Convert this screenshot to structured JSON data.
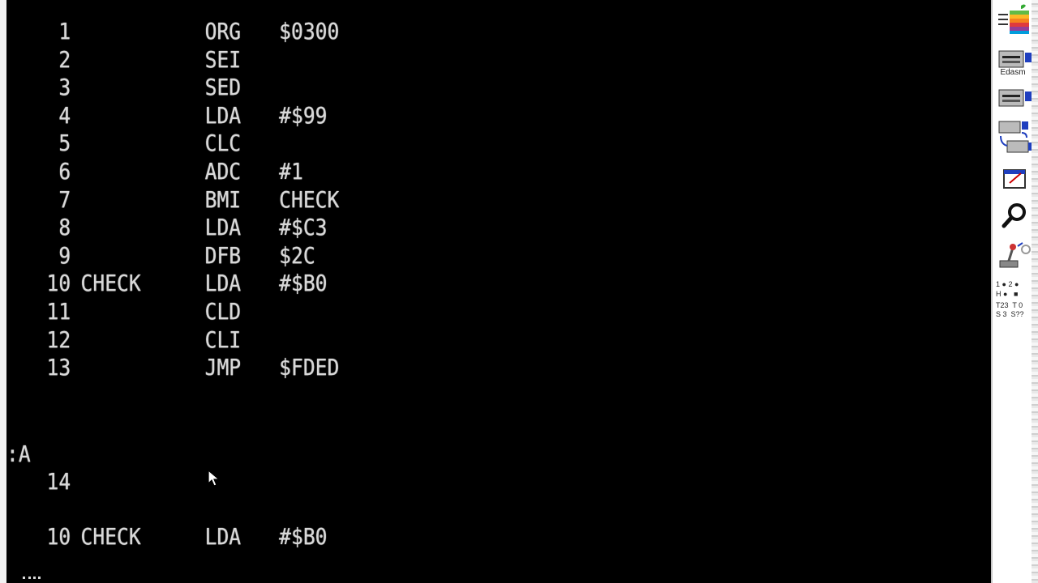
{
  "listing": [
    {
      "num": "1",
      "label": "",
      "op": "ORG",
      "arg": "$0300"
    },
    {
      "num": "2",
      "label": "",
      "op": "SEI",
      "arg": ""
    },
    {
      "num": "3",
      "label": "",
      "op": "SED",
      "arg": ""
    },
    {
      "num": "4",
      "label": "",
      "op": "LDA",
      "arg": "#$99"
    },
    {
      "num": "5",
      "label": "",
      "op": "CLC",
      "arg": ""
    },
    {
      "num": "6",
      "label": "",
      "op": "ADC",
      "arg": "#1"
    },
    {
      "num": "7",
      "label": "",
      "op": "BMI",
      "arg": "CHECK"
    },
    {
      "num": "8",
      "label": "",
      "op": "LDA",
      "arg": "#$C3"
    },
    {
      "num": "9",
      "label": "",
      "op": "DFB",
      "arg": "$2C"
    },
    {
      "num": "10",
      "label": "CHECK",
      "op": "LDA",
      "arg": "#$B0"
    },
    {
      "num": "11",
      "label": "",
      "op": "CLD",
      "arg": ""
    },
    {
      "num": "12",
      "label": "",
      "op": "CLI",
      "arg": ""
    },
    {
      "num": "13",
      "label": "",
      "op": "JMP",
      "arg": "$FDED"
    }
  ],
  "prompt": ":A",
  "next_line_num": "14",
  "edit_line": {
    "num": "10",
    "label": "CHECK",
    "op": "LDA",
    "arg": "#$B0"
  },
  "sidebar": {
    "edasm_caption": "Edasm",
    "drive1_badge": "1",
    "drive2_badge": "2",
    "status_rows": [
      "1 ● 2 ●",
      "H ●   ■",
      "T23  T 0",
      "S 3  S??"
    ]
  },
  "colors": {
    "screen_bg": "#000000",
    "screen_text": "#d8d8d8",
    "accent_blue": "#1f3fbf"
  }
}
